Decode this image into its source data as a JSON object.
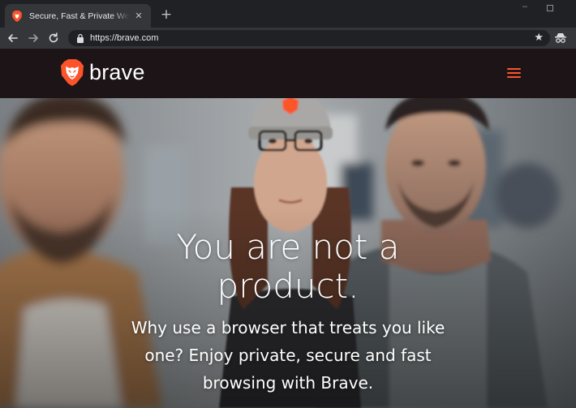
{
  "browser": {
    "tab": {
      "title": "Secure, Fast & Private Web Browser with Adblocker | Brave Browser",
      "favicon": "brave-lion-icon",
      "close_icon": "✕"
    },
    "new_tab_icon": "+",
    "window": {
      "minimize_icon": "‒"
    },
    "toolbar": {
      "back_icon": "arrow-left-icon",
      "forward_icon": "arrow-right-icon",
      "reload_icon": "reload-icon",
      "url": "https://brave.com",
      "bookmark_icon": "★"
    }
  },
  "site": {
    "brand_name": "brave",
    "accent_color": "#fb542b",
    "hero": {
      "headline_line1": "You are not a",
      "headline_line2": "product.",
      "subhead_line1": "Why use a browser that treats you like",
      "subhead_line2": "one? Enjoy private, secure and fast",
      "subhead_line3": "browsing with Brave."
    }
  }
}
